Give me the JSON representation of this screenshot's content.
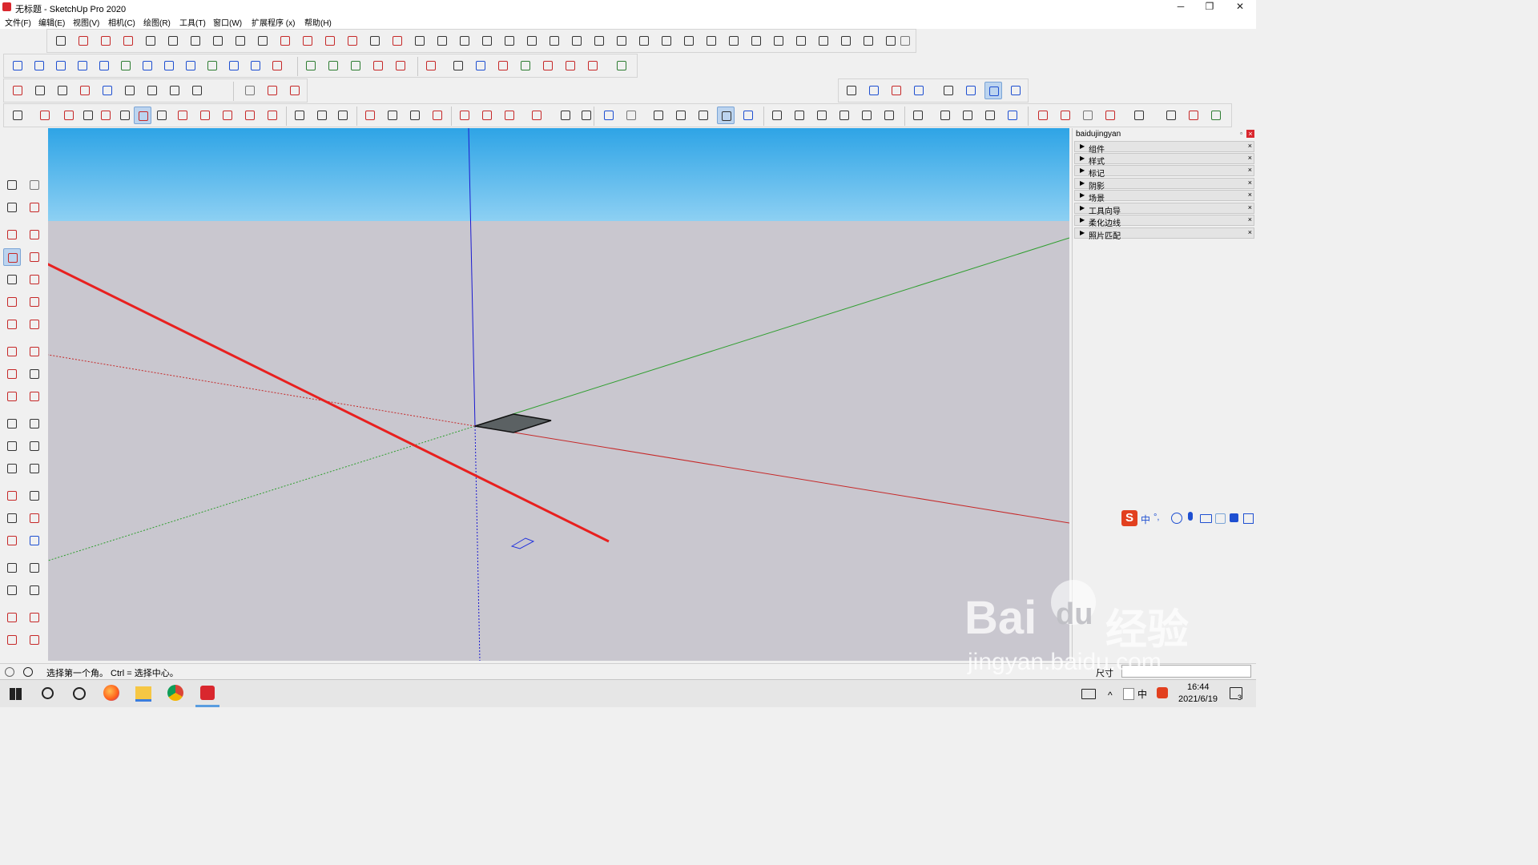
{
  "window": {
    "title": "无标题 - SketchUp Pro 2020",
    "minimize_glyph": "─",
    "restore_glyph": "❐",
    "close_glyph": "✕"
  },
  "menu": {
    "items": [
      {
        "label": "文件(F)"
      },
      {
        "label": "编辑(E)"
      },
      {
        "label": "视图(V)"
      },
      {
        "label": "相机(C)"
      },
      {
        "label": "绘图(R)"
      },
      {
        "label": "工具(T)"
      },
      {
        "label": "窗口(W)"
      },
      {
        "label": "扩展程序 (x)"
      },
      {
        "label": "帮助(H)"
      }
    ]
  },
  "tray": {
    "title": "baidujingyan",
    "pin_glyph": "▫",
    "close_glyph": "×",
    "expand_glyph": "▶",
    "remove_glyph": "×",
    "panels": [
      {
        "label": "组件"
      },
      {
        "label": "样式"
      },
      {
        "label": "标记"
      },
      {
        "label": "阴影"
      },
      {
        "label": "场景"
      },
      {
        "label": "工具向导"
      },
      {
        "label": "柔化边线"
      },
      {
        "label": "照片匹配"
      }
    ]
  },
  "status": {
    "message": "选择第一个角。 Ctrl = 选择中心。",
    "size_label": "尺寸",
    "size_value": ""
  },
  "ime": {
    "logo": "S",
    "lang": "中",
    "punct": "°,"
  },
  "taskbar": {
    "time": "16:44",
    "date": "2021/6/19",
    "notification_count": "3",
    "ime_lang": "中"
  },
  "watermark": {
    "brand": "Bai",
    "brand2": "du",
    "site_cn": "经验",
    "url": "jingyan.baidu.com"
  },
  "colors": {
    "accent_red": "#d9272e",
    "sky_top": "#2ea4e6",
    "ground": "#c9c7cf",
    "axis_red": "#c62828",
    "axis_green": "#2e9e2e",
    "axis_blue": "#1a1ad0"
  }
}
